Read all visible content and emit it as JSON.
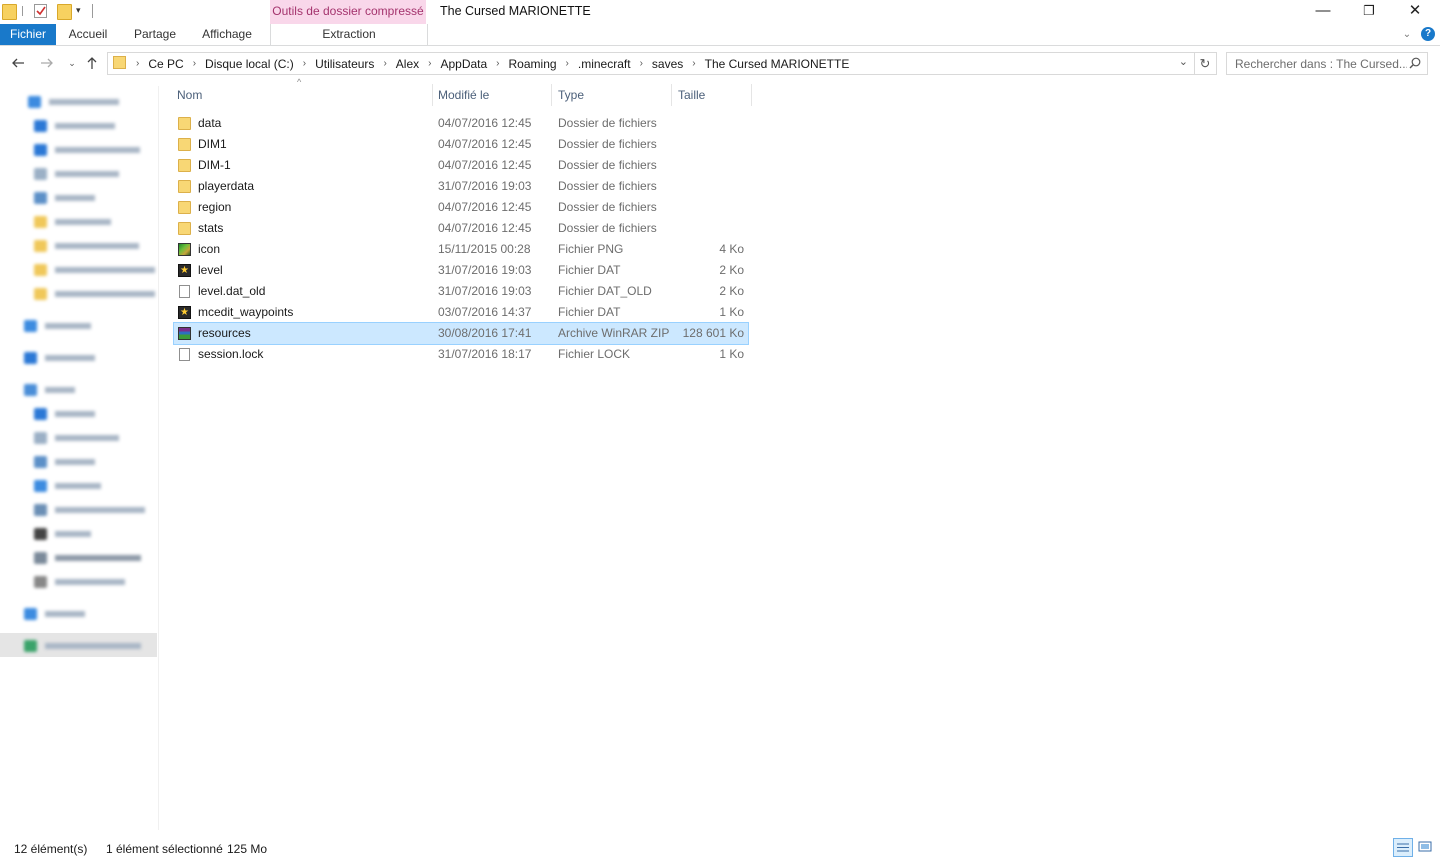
{
  "window": {
    "title": "The Cursed MARIONETTE",
    "context_tab_header": "Outils de dossier compressé",
    "controls": {
      "minimize": "—",
      "maximize": "❐",
      "close": "✕"
    }
  },
  "ribbon": {
    "tabs": [
      "Fichier",
      "Accueil",
      "Partage",
      "Affichage"
    ],
    "context_tab": "Extraction",
    "accent": "#1979ca",
    "context_color": "#f9d7ea"
  },
  "address": {
    "crumbs": [
      "Ce PC",
      "Disque local (C:)",
      "Utilisateurs",
      "Alex",
      "AppData",
      "Roaming",
      ".minecraft",
      "saves",
      "The Cursed MARIONETTE"
    ],
    "search_placeholder": "Rechercher dans : The Cursed..."
  },
  "columns": {
    "name": "Nom",
    "date": "Modifié le",
    "type": "Type",
    "size": "Taille"
  },
  "files": [
    {
      "name": "data",
      "date": "04/07/2016 12:45",
      "type": "Dossier de fichiers",
      "size": "",
      "icon": "folder-icon"
    },
    {
      "name": "DIM1",
      "date": "04/07/2016 12:45",
      "type": "Dossier de fichiers",
      "size": "",
      "icon": "folder-icon"
    },
    {
      "name": "DIM-1",
      "date": "04/07/2016 12:45",
      "type": "Dossier de fichiers",
      "size": "",
      "icon": "folder-icon"
    },
    {
      "name": "playerdata",
      "date": "31/07/2016 19:03",
      "type": "Dossier de fichiers",
      "size": "",
      "icon": "folder-icon"
    },
    {
      "name": "region",
      "date": "04/07/2016 12:45",
      "type": "Dossier de fichiers",
      "size": "",
      "icon": "folder-icon"
    },
    {
      "name": "stats",
      "date": "04/07/2016 12:45",
      "type": "Dossier de fichiers",
      "size": "",
      "icon": "folder-icon"
    },
    {
      "name": "icon",
      "date": "15/11/2015 00:28",
      "type": "Fichier PNG",
      "size": "4 Ko",
      "icon": "png-image-icon"
    },
    {
      "name": "level",
      "date": "31/07/2016 19:03",
      "type": "Fichier DAT",
      "size": "2 Ko",
      "icon": "dat-file-icon"
    },
    {
      "name": "level.dat_old",
      "date": "31/07/2016 19:03",
      "type": "Fichier DAT_OLD",
      "size": "2 Ko",
      "icon": "blank-file-icon"
    },
    {
      "name": "mcedit_waypoints",
      "date": "03/07/2016 14:37",
      "type": "Fichier DAT",
      "size": "1 Ko",
      "icon": "dat-file-icon"
    },
    {
      "name": "resources",
      "date": "30/08/2016 17:41",
      "type": "Archive WinRAR ZIP",
      "size": "128 601 Ko",
      "icon": "winrar-archive-icon",
      "selected": true
    },
    {
      "name": "session.lock",
      "date": "31/07/2016 18:17",
      "type": "Fichier LOCK",
      "size": "1 Ko",
      "icon": "blank-file-icon"
    }
  ],
  "status": {
    "count": "12 élément(s)",
    "selection": "1 élément sélectionné",
    "selection_size": "125 Mo"
  }
}
